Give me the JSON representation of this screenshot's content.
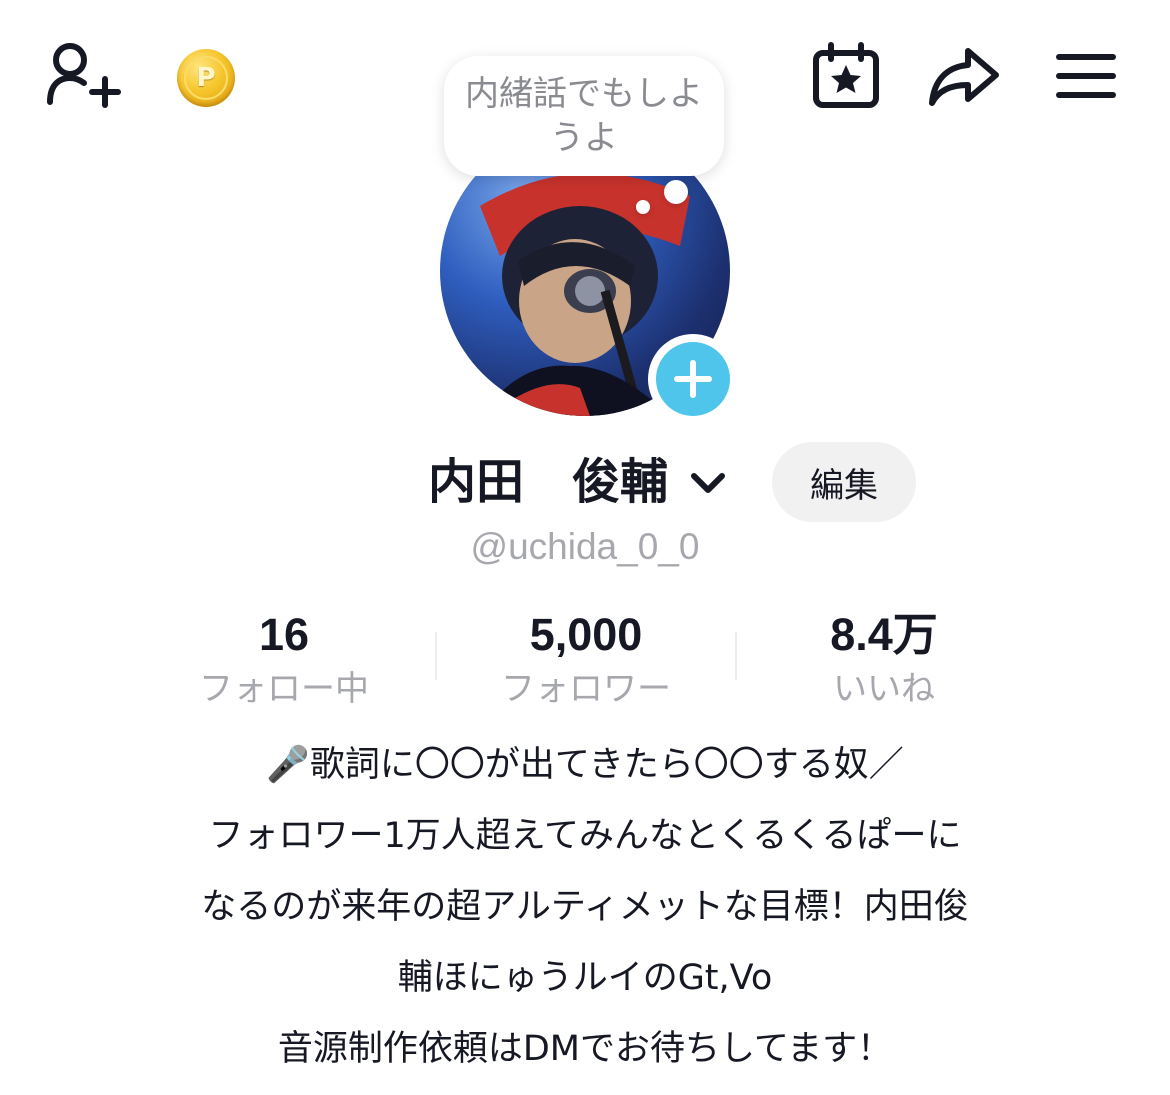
{
  "header": {
    "icons": {
      "add_friend": "person-plus-icon",
      "coin": "coin-icon",
      "calendar": "calendar-star-icon",
      "share": "share-arrow-icon",
      "menu": "hamburger-menu-icon"
    },
    "coin_letter": "P"
  },
  "profile": {
    "thought_bubble": "内緒話でもしようよ",
    "display_name": "内田　俊輔",
    "username": "@uchida_0_0",
    "edit_label": "編集",
    "avatar_plus_color": "#4fc5ec"
  },
  "stats": {
    "following": {
      "value": "16",
      "label": "フォロー中"
    },
    "followers": {
      "value": "5,000",
      "label": "フォロワー"
    },
    "likes": {
      "value": "8.4万",
      "label": "いいね"
    }
  },
  "bio": {
    "lines": [
      "🎤歌詞に〇〇が出てきたら〇〇する奴／",
      "フォロワー1万人超えてみんなとくるくるぱーに",
      "なるのが来年の超アルティメットな目標！内田俊",
      "輔ほにゅうルイのGt,Vo",
      "音源制作依頼はDMでお待ちしてます！"
    ]
  }
}
